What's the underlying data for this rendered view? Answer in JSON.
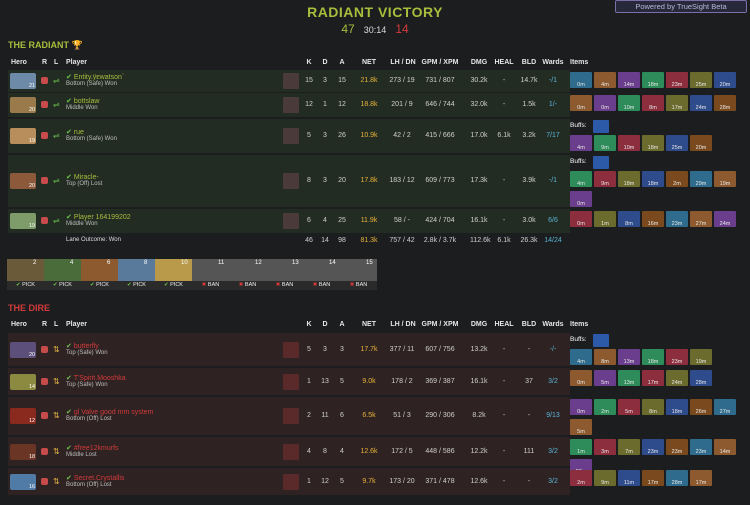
{
  "header": {
    "title": "RADIANT VICTORY",
    "radiant_score": "47",
    "duration": "30:14",
    "dire_score": "14",
    "powered_by": "Powered by TrueSight Beta"
  },
  "columns": {
    "hero": "Hero",
    "r": "R",
    "l": "L",
    "player": "Player",
    "k": "K",
    "d": "D",
    "a": "A",
    "net": "NET",
    "lh_dn": "LH / DN",
    "gpm_xpm": "GPM / XPM",
    "dmg": "DMG",
    "heal": "HEAL",
    "bld": "BLD",
    "wards": "Wards",
    "items": "Items"
  },
  "radiant": {
    "title": "THE RADIANT",
    "players": [
      {
        "level": "21",
        "name": "Entity.ÿᴇwatson`",
        "result": "Bottom (Safe) Won",
        "k": "15",
        "d": "3",
        "a": "15",
        "net": "21.8k",
        "lh_dn": "273 / 19",
        "gpm_xpm": "731 / 807",
        "dmg": "30.2k",
        "heal": "-",
        "bld": "14.7k",
        "wards": "-/1",
        "items": [
          "0m",
          "4m",
          "14m",
          "18m",
          "23m",
          "25m",
          "20m"
        ],
        "buffs": ""
      },
      {
        "level": "20",
        "name": "bottslaw",
        "result": "Middle Won",
        "k": "12",
        "d": "1",
        "a": "12",
        "net": "18.8k",
        "lh_dn": "201 / 9",
        "gpm_xpm": "646 / 744",
        "dmg": "32.0k",
        "heal": "-",
        "bld": "1.5k",
        "wards": "1/-",
        "items": [
          "0m",
          "0m",
          "10m",
          "8m",
          "17m",
          "24m",
          "28m"
        ],
        "buffs": ""
      },
      {
        "level": "19",
        "name": "rue",
        "result": "Bottom (Safe) Won",
        "k": "5",
        "d": "3",
        "a": "26",
        "net": "10.9k",
        "lh_dn": "42 / 2",
        "gpm_xpm": "415 / 666",
        "dmg": "17.0k",
        "heal": "6.1k",
        "bld": "3.2k",
        "wards": "7/17",
        "items": [
          "4m",
          "9m",
          "10m",
          "18m",
          "25m",
          "20m"
        ],
        "buffs": "Buffs:"
      },
      {
        "level": "20",
        "name": "Miracle-",
        "result": "Top (Off) Lost",
        "k": "8",
        "d": "3",
        "a": "20",
        "net": "17.8k",
        "lh_dn": "183 / 12",
        "gpm_xpm": "609 / 773",
        "dmg": "17.3k",
        "heal": "-",
        "bld": "3.9k",
        "wards": "-/1",
        "items": [
          "4m",
          "9m",
          "18m",
          "18m",
          "2m",
          "29m",
          "19m",
          "0m"
        ],
        "buffs": "Buffs:"
      },
      {
        "level": "19",
        "name": "Player 164199202",
        "result": "Middle Won",
        "k": "6",
        "d": "4",
        "a": "25",
        "net": "11.9k",
        "lh_dn": "58 / -",
        "gpm_xpm": "424 / 704",
        "dmg": "16.1k",
        "heal": "-",
        "bld": "3.0k",
        "wards": "6/6",
        "items": [
          "0m",
          "1m",
          "8m",
          "16m",
          "23m",
          "27m",
          "24m"
        ],
        "buffs": ""
      }
    ],
    "lane_outcome": "Lane Outcome: Won",
    "totals": {
      "k": "46",
      "d": "14",
      "a": "98",
      "net": "81.3k",
      "lh_dn": "757 / 42",
      "gpm_xpm": "2.8k / 3.7k",
      "dmg": "112.6k",
      "heal": "6.1k",
      "bld": "26.3k",
      "wards": "14/24"
    }
  },
  "picks_bans": [
    {
      "num": "2",
      "label": "PICK"
    },
    {
      "num": "4",
      "label": "PICK"
    },
    {
      "num": "6",
      "label": "PICK"
    },
    {
      "num": "8",
      "label": "PICK"
    },
    {
      "num": "10",
      "label": "PICK"
    },
    {
      "num": "11",
      "label": "BAN"
    },
    {
      "num": "12",
      "label": "BAN"
    },
    {
      "num": "13",
      "label": "BAN"
    },
    {
      "num": "14",
      "label": "BAN"
    },
    {
      "num": "15",
      "label": "BAN"
    }
  ],
  "dire": {
    "title": "THE DIRE",
    "players": [
      {
        "level": "20",
        "name": "butterfly",
        "result": "Top (Safe) Won",
        "k": "5",
        "d": "3",
        "a": "3",
        "net": "17.7k",
        "lh_dn": "377 / 11",
        "gpm_xpm": "607 / 756",
        "dmg": "13.2k",
        "heal": "-",
        "bld": "-",
        "wards": "-/-",
        "items": [
          "4m",
          "8m",
          "13m",
          "18m",
          "23m",
          "19m"
        ],
        "buffs": "Buffs:"
      },
      {
        "level": "14",
        "name": "T'Spirit.Mooshka",
        "result": "Top (Safe) Won",
        "k": "1",
        "d": "13",
        "a": "5",
        "net": "9.0k",
        "lh_dn": "178 / 2",
        "gpm_xpm": "369 / 387",
        "dmg": "16.1k",
        "heal": "-",
        "bld": "37",
        "wards": "3/2",
        "items": [
          "0m",
          "5m",
          "13m",
          "17m",
          "24m",
          "28m"
        ],
        "buffs": ""
      },
      {
        "level": "12",
        "name": "gl Valve good mm system",
        "result": "Bottom (Off) Lost",
        "k": "2",
        "d": "11",
        "a": "6",
        "net": "6.5k",
        "lh_dn": "51 / 3",
        "gpm_xpm": "290 / 306",
        "dmg": "8.2k",
        "heal": "-",
        "bld": "-",
        "wards": "9/13",
        "items": [
          "0m",
          "2m",
          "5m",
          "8m",
          "18m",
          "26m",
          "27m",
          "5m"
        ],
        "buffs": ""
      },
      {
        "level": "18",
        "name": "#free12kmurfs",
        "result": "Middle Lost",
        "k": "4",
        "d": "8",
        "a": "4",
        "net": "12.6k",
        "lh_dn": "172 / 5",
        "gpm_xpm": "448 / 586",
        "dmg": "12.2k",
        "heal": "-",
        "bld": "111",
        "wards": "3/2",
        "items": [
          "1m",
          "3m",
          "7m",
          "23m",
          "23m",
          "23m",
          "14m",
          "28m"
        ],
        "buffs": ""
      },
      {
        "level": "16",
        "name": "Secret.Crystallis",
        "result": "Bottom (Off) Lost",
        "k": "1",
        "d": "12",
        "a": "5",
        "net": "9.7k",
        "lh_dn": "173 / 20",
        "gpm_xpm": "371 / 478",
        "dmg": "12.6k",
        "heal": "-",
        "bld": "-",
        "wards": "3/2",
        "items": [
          "2m",
          "9m",
          "11m",
          "17m",
          "28m",
          "17m"
        ],
        "buffs": ""
      }
    ]
  }
}
